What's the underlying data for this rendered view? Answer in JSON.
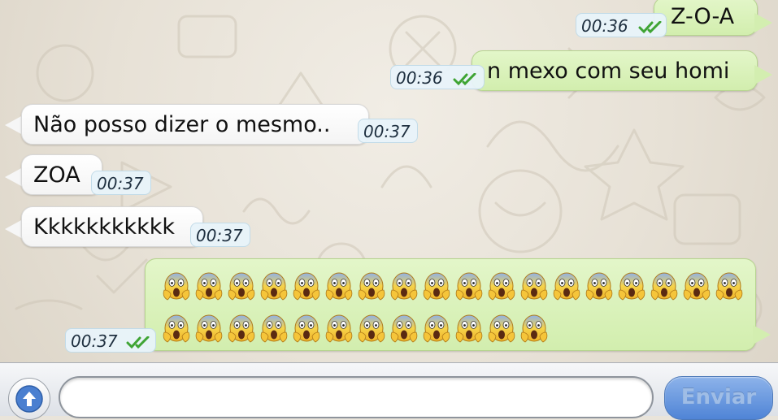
{
  "conversation": {
    "messages": [
      {
        "direction": "outgoing",
        "text": "Z-O-A",
        "time": "00:36",
        "status": "read-double-check"
      },
      {
        "direction": "outgoing",
        "text": "n mexo com seu homi",
        "time": "00:36",
        "status": "read-double-check"
      },
      {
        "direction": "incoming",
        "text": "Não posso dizer o mesmo..",
        "time": "00:37"
      },
      {
        "direction": "incoming",
        "text": "ZOA",
        "time": "00:37"
      },
      {
        "direction": "incoming",
        "text": "Kkkkkkkkkkk",
        "time": "00:37"
      },
      {
        "direction": "outgoing",
        "emoji": "face-screaming-in-fear",
        "emoji_count_row1": 18,
        "emoji_count_row2": 12,
        "time": "00:37",
        "status": "read-double-check"
      }
    ]
  },
  "composer": {
    "send_label": "Enviar",
    "input_value": "",
    "attach_icon": "arrow-up-circle-icon"
  },
  "colors": {
    "outgoing_bubble": "#d9f2b9",
    "incoming_bubble": "#ffffff",
    "check_color": "#3fa434",
    "send_button": "#5a8cd9"
  }
}
